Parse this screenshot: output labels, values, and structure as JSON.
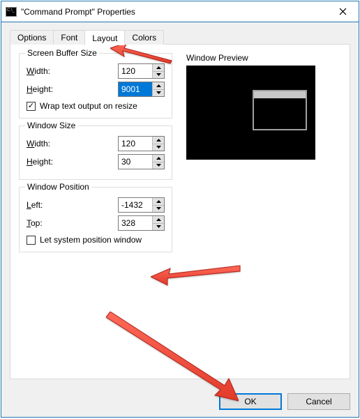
{
  "window": {
    "title": "\"Command Prompt\" Properties",
    "close_icon": "close-icon"
  },
  "tabs": {
    "items": [
      {
        "label": "Options",
        "active": false
      },
      {
        "label": "Font",
        "active": false
      },
      {
        "label": "Layout",
        "active": true
      },
      {
        "label": "Colors",
        "active": false
      }
    ]
  },
  "screen_buffer": {
    "legend": "Screen Buffer Size",
    "width_label_pre": "",
    "width_u": "W",
    "width_rest": "idth:",
    "height_label_pre": "",
    "height_u": "H",
    "height_rest": "eight:",
    "width_value": "120",
    "height_value": "9001",
    "wrap_u": "W",
    "wrap_rest": "rap text output on resize",
    "wrap_checked": true
  },
  "window_size": {
    "legend": "Window Size",
    "width_u": "W",
    "width_rest": "idth:",
    "height_u": "H",
    "height_rest": "eight:",
    "width_value": "120",
    "height_value": "30"
  },
  "window_position": {
    "legend": "Window Position",
    "left_u": "L",
    "left_rest": "eft:",
    "top_u": "T",
    "top_rest": "op:",
    "left_value": "-1432",
    "top_value": "328",
    "letsys_pre": "Let system ",
    "letsys_u": "p",
    "letsys_rest": "osition window",
    "letsys_checked": false
  },
  "preview": {
    "label": "Window Preview"
  },
  "buttons": {
    "ok": "OK",
    "cancel": "Cancel"
  }
}
